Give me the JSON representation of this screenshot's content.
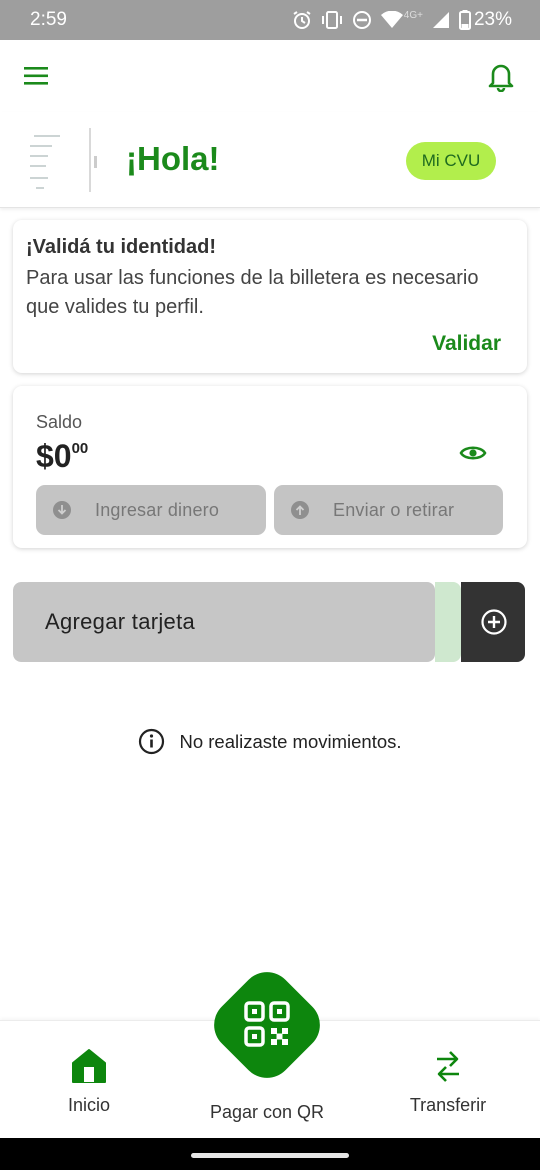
{
  "status_bar": {
    "time": "2:59",
    "network": "4G+",
    "battery": "23%",
    "icons": [
      "alarm-icon",
      "vibrate-icon",
      "dnd-icon",
      "wifi-icon",
      "signal-icon",
      "battery-icon"
    ]
  },
  "header": {
    "icons": [
      "menu-icon",
      "bell-icon"
    ]
  },
  "greeting": {
    "title": "¡Hola!",
    "cvu_button": "Mi CVU"
  },
  "validate_card": {
    "title": "¡Validá tu identidad!",
    "text": "Para usar las funciones de la billetera es necesario que valides tu perfil.",
    "link": "Validar"
  },
  "balance": {
    "label": "Saldo",
    "amount": "$0",
    "cents": "00",
    "deposit_button": "Ingresar dinero",
    "withdraw_button": "Enviar o retirar"
  },
  "add_card": {
    "label": "Agregar tarjeta"
  },
  "movements": {
    "empty_text": "No realizaste movimientos."
  },
  "bottom_nav": {
    "home": "Inicio",
    "qr": "Pagar con QR",
    "transfer": "Transferir"
  },
  "colors": {
    "brand_green": "#1b8a1b",
    "cvu_lime": "#b2ee4c",
    "qr_green": "#0d860d",
    "disabled_gray": "#c4c4c4",
    "dark": "#333333"
  }
}
